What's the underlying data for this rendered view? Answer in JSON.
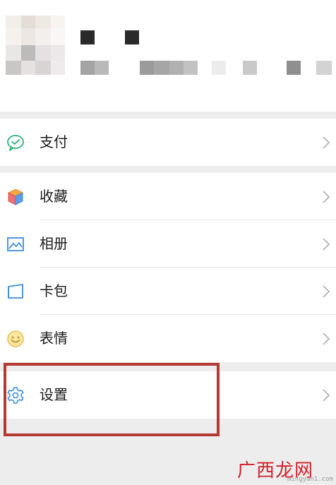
{
  "menu": {
    "pay": {
      "label": "支付",
      "icon": "wechat-pay-icon"
    },
    "favorites": {
      "label": "收藏",
      "icon": "favorites-cube-icon"
    },
    "album": {
      "label": "相册",
      "icon": "album-picture-icon"
    },
    "cards": {
      "label": "卡包",
      "icon": "card-wallet-icon"
    },
    "stickers": {
      "label": "表情",
      "icon": "smiley-icon"
    },
    "settings": {
      "label": "设置",
      "icon": "settings-gear-icon"
    }
  },
  "watermark": {
    "chinese": "广西龙网",
    "url": "mingyan1.com"
  },
  "colors": {
    "pay_green": "#2ab27b",
    "highlight_red": "#b23a33",
    "watermark_red": "#d21f2a",
    "background": "#ededed",
    "text": "#1b1b1b"
  }
}
